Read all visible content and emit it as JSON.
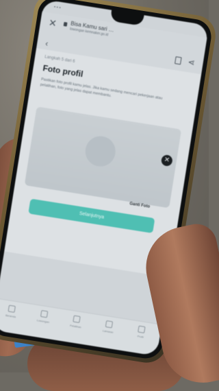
{
  "browser": {
    "site_title": "Bisa Kamu sari …",
    "site_url": "lowongan kemnaker.go.id"
  },
  "page": {
    "step": "Langkah 5 dari 6",
    "title": "Foto profil",
    "description": "Pastikan foto profil kamu jelas. Jika kamu sedang mencari pekerjaan atau pelatihan, foto yang jelas dapat membantu.",
    "primary_button": "Selanjutnya",
    "change_photo": "Ganti Foto"
  },
  "bottom_nav": {
    "items": [
      "Beranda",
      "Lowongan",
      "Pelatihan",
      "Lamaran",
      "Profil"
    ]
  },
  "icons": {
    "close": "close-icon",
    "lock": "lock-icon",
    "back": "back-arrow-icon",
    "bookmark": "bookmark-icon",
    "share": "share-icon",
    "remove": "remove-photo-icon"
  },
  "colors": {
    "accent": "#4fbfb3",
    "screen": "#cfd4d8"
  }
}
